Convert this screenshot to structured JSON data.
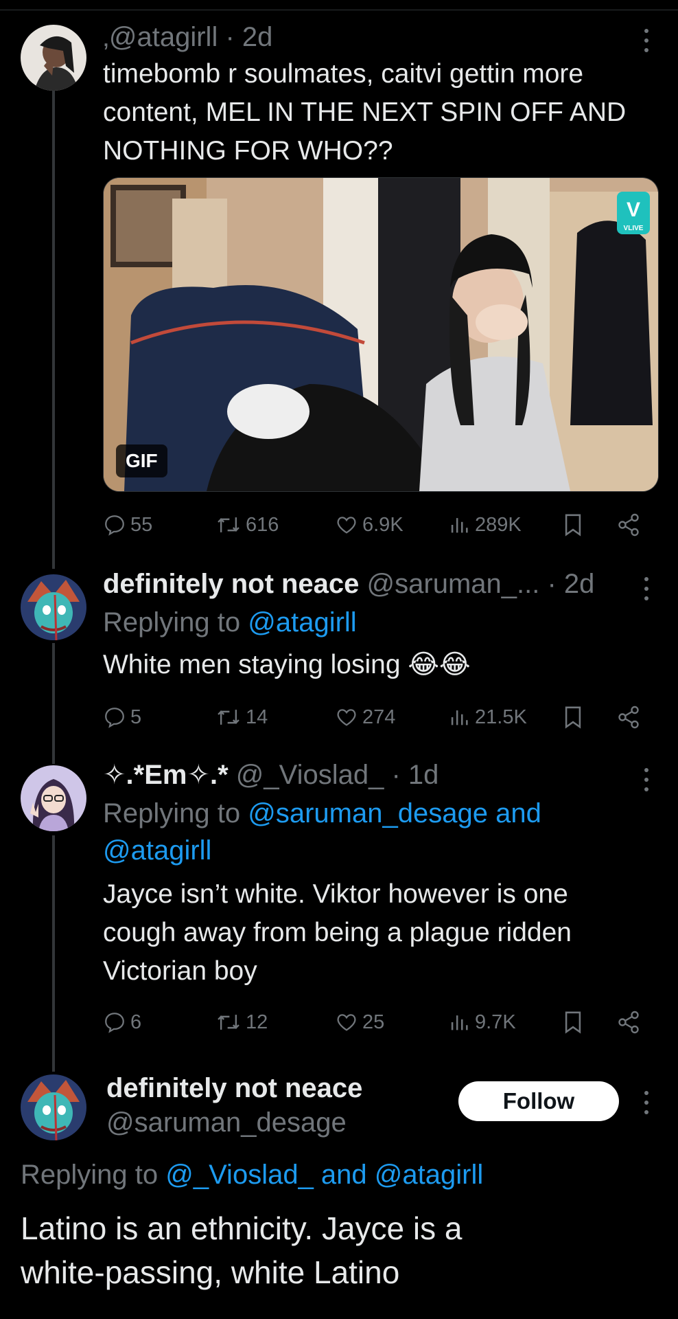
{
  "tweets": [
    {
      "handle_line": "‚@atagirll · 2d",
      "text_lines": [
        "timebomb r soulmates, caitvi gettin more",
        "content, MEL IN THE NEXT SPIN OFF AND",
        "NOTHING FOR WHO??"
      ],
      "media": {
        "badge": "GIF",
        "corner_logo": "VLIVE"
      },
      "stats": {
        "replies": "55",
        "retweets": "616",
        "likes": "6.9K",
        "views": "289K"
      }
    },
    {
      "name": "definitely not neace",
      "handle": "@saruman_...",
      "time": "· 2d",
      "replying_prefix": "Replying to",
      "replying_to": "@atagirll",
      "text_lines": [
        "White men staying losing 😂😂"
      ],
      "stats": {
        "replies": "5",
        "retweets": "14",
        "likes": "274",
        "views": "21.5K"
      }
    },
    {
      "name": "✧.*Em✧.*",
      "handle": "@_Vioslad_",
      "time": "· 1d",
      "replying_prefix": "Replying to",
      "replying_to_line1": "@saruman_desage and",
      "replying_to_line2": "@atagirll",
      "text_lines": [
        "Jayce isn’t white. Viktor however is one",
        "cough away from being a plague ridden",
        "Victorian boy"
      ],
      "stats": {
        "replies": "6",
        "retweets": "12",
        "likes": "25",
        "views": "9.7K"
      }
    }
  ],
  "main_tweet": {
    "name": "definitely not neace",
    "handle": "@saruman_desage",
    "follow_label": "Follow",
    "replying_prefix": "Replying to",
    "replying_to": "@_Vioslad_ and @atagirll",
    "text_lines": [
      "Latino is an ethnicity. Jayce is a",
      "white-passing, white Latino"
    ]
  },
  "colors": {
    "background": "#000000",
    "text": "#e7e9ea",
    "muted": "#71767b",
    "link": "#1d9bf0"
  }
}
